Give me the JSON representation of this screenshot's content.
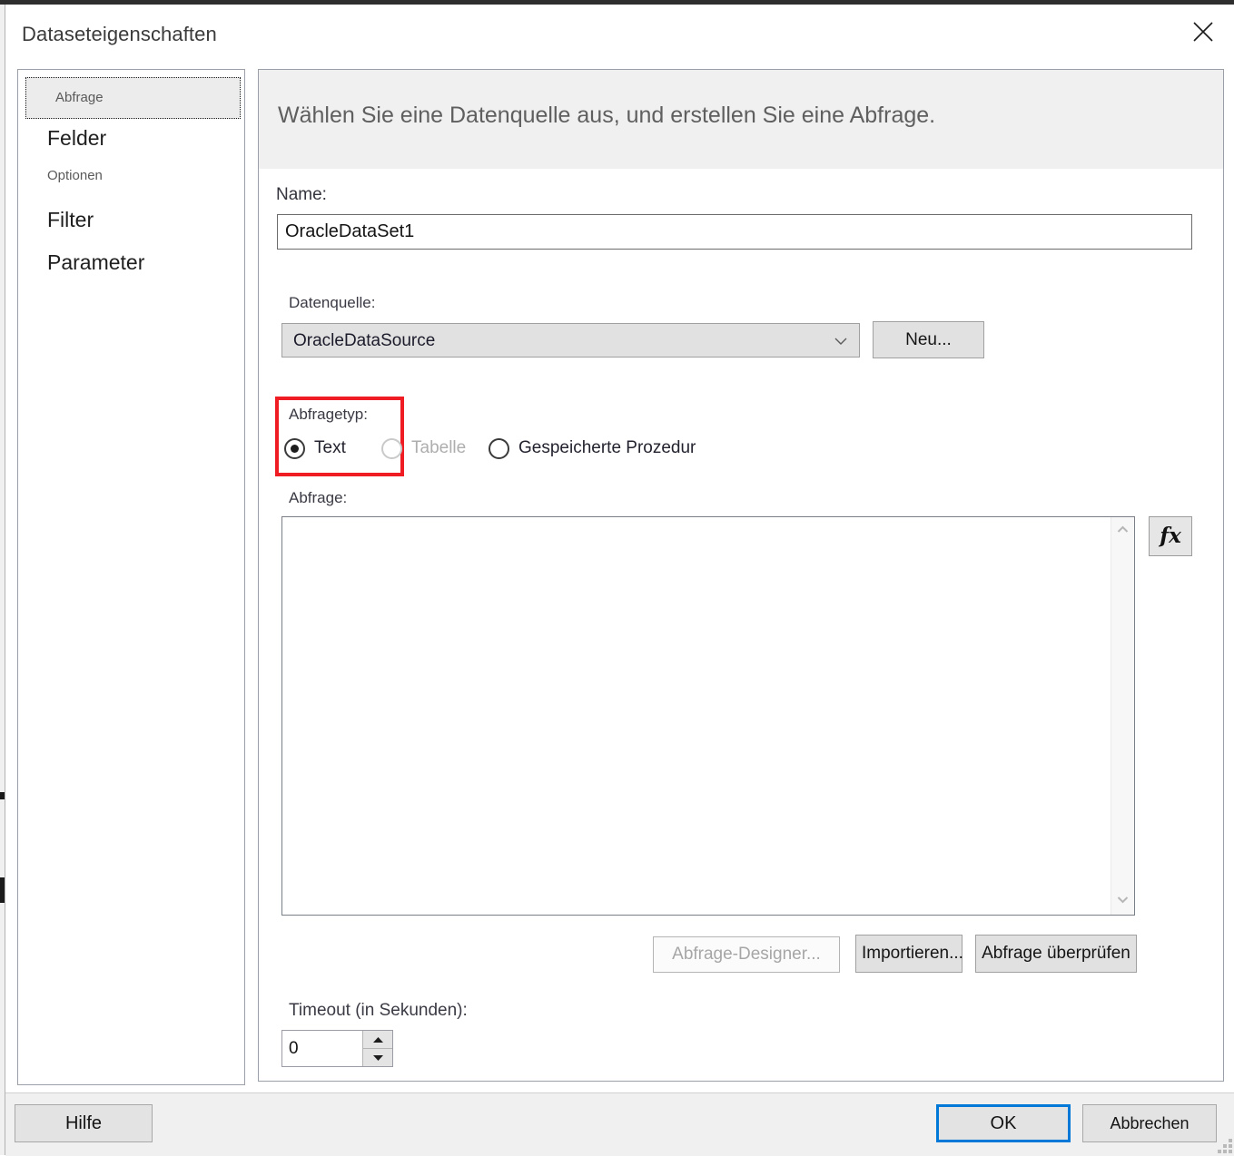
{
  "window": {
    "title": "Dataseteigenschaften",
    "close_icon": "close-icon"
  },
  "sidebar": {
    "items": [
      {
        "label": "Abfrage",
        "selected": true,
        "style": "small"
      },
      {
        "label": "Felder",
        "selected": false,
        "style": "large"
      },
      {
        "label": "Optionen",
        "selected": false,
        "style": "small"
      },
      {
        "label": "Filter",
        "selected": false,
        "style": "large"
      },
      {
        "label": "Parameter",
        "selected": false,
        "style": "large"
      }
    ]
  },
  "main": {
    "header": "Wählen Sie eine Datenquelle aus, und erstellen Sie eine Abfrage.",
    "name": {
      "label": "Name:",
      "value": "OracleDataSet1",
      "placeholder": ""
    },
    "datasource": {
      "label": "Datenquelle:",
      "value": "OracleDataSource",
      "arrow_icon": "chevron-down-icon",
      "new_button": "Neu..."
    },
    "querytype": {
      "label": "Abfragetyp:",
      "highlight_color": "#ef1c24",
      "options": [
        {
          "label": "Text",
          "selected": true,
          "disabled": false
        },
        {
          "label": "Tabelle",
          "selected": false,
          "disabled": true
        },
        {
          "label": "Gespeicherte Prozedur",
          "selected": false,
          "disabled": false
        }
      ]
    },
    "query": {
      "label": "Abfrage:",
      "value": "",
      "placeholder": "",
      "scroll_up_icon": "chevron-up-icon",
      "scroll_down_icon": "chevron-down-icon",
      "fx_button": "fx",
      "fx_icon": "function-icon"
    },
    "actions": [
      {
        "label": "Abfrage-Designer...",
        "disabled": true
      },
      {
        "label": "Importieren...",
        "disabled": false
      },
      {
        "label": "Abfrage überprüfen",
        "disabled": false
      }
    ],
    "timeout": {
      "label": "Timeout (in Sekunden):",
      "value": "0",
      "up_icon": "spinner-up-icon",
      "down_icon": "spinner-down-icon"
    }
  },
  "footer": {
    "help": "Hilfe",
    "ok": "OK",
    "cancel": "Abbrechen",
    "ok_focus_color": "#0078d7",
    "grip_icon": "resize-grip-icon"
  }
}
